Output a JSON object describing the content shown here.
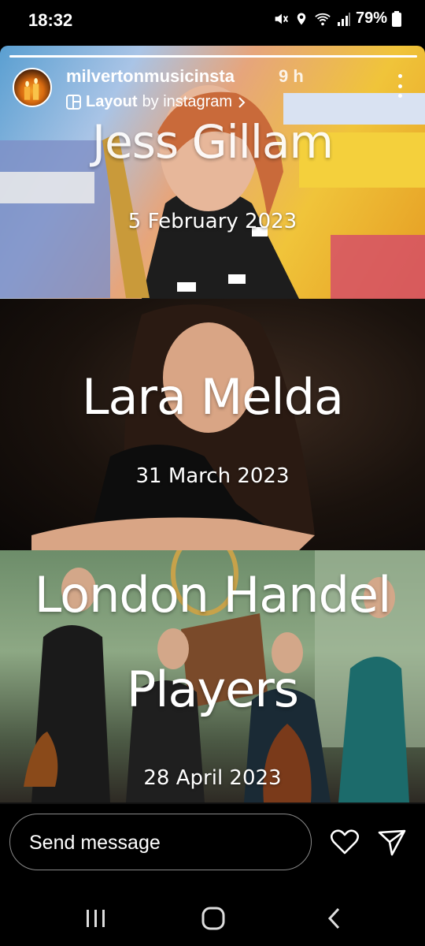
{
  "status_bar": {
    "time": "18:32",
    "battery": "79%",
    "icons": [
      "mute-icon",
      "location-icon",
      "wifi-icon",
      "signal-icon",
      "battery-icon"
    ]
  },
  "story": {
    "progress": 1.0,
    "account": "milvertonmusicinsta",
    "age": "9 h",
    "layout_label": "Layout",
    "layout_suffix": "by instagram",
    "panels": [
      {
        "title": "Jess Gillam",
        "date": "5 February 2023"
      },
      {
        "title": "Lara Melda",
        "date": "31 March 2023"
      },
      {
        "title_line1": "London Handel",
        "title_line2": "Players",
        "date": "28 April 2023"
      }
    ]
  },
  "reply": {
    "placeholder": "Send message"
  },
  "colors": {
    "background": "#000000",
    "text": "#ffffff",
    "input_border": "#8a8a8a"
  }
}
